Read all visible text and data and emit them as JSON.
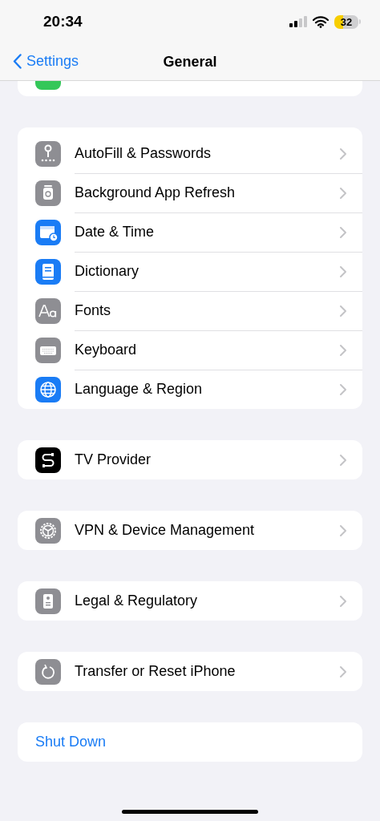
{
  "status_bar": {
    "time": "20:34",
    "battery": "32"
  },
  "nav": {
    "back": "Settings",
    "title": "General"
  },
  "groups": [
    {
      "items": [
        {
          "label": "AutoFill & Passwords",
          "kind": "key",
          "color": "#8e8e93"
        },
        {
          "label": "Background App Refresh",
          "kind": "refresh",
          "color": "#8e8e93"
        },
        {
          "label": "Date & Time",
          "kind": "calendar",
          "color": "#1a7cf5"
        },
        {
          "label": "Dictionary",
          "kind": "book",
          "color": "#1a7cf5"
        },
        {
          "label": "Fonts",
          "kind": "fonts",
          "color": "#8e8e93"
        },
        {
          "label": "Keyboard",
          "kind": "keyboard",
          "color": "#8e8e93"
        },
        {
          "label": "Language & Region",
          "kind": "globe",
          "color": "#1a7cf5"
        }
      ]
    },
    {
      "items": [
        {
          "label": "TV Provider",
          "kind": "cable",
          "color": "#000000"
        }
      ]
    },
    {
      "items": [
        {
          "label": "VPN & Device Management",
          "kind": "gear",
          "color": "#8e8e93"
        }
      ]
    },
    {
      "items": [
        {
          "label": "Legal & Regulatory",
          "kind": "document",
          "color": "#8e8e93"
        }
      ]
    },
    {
      "items": [
        {
          "label": "Transfer or Reset iPhone",
          "kind": "reset",
          "color": "#8e8e93"
        }
      ]
    },
    {
      "items": [
        {
          "label": "Shut Down",
          "kind": "action"
        }
      ]
    }
  ]
}
